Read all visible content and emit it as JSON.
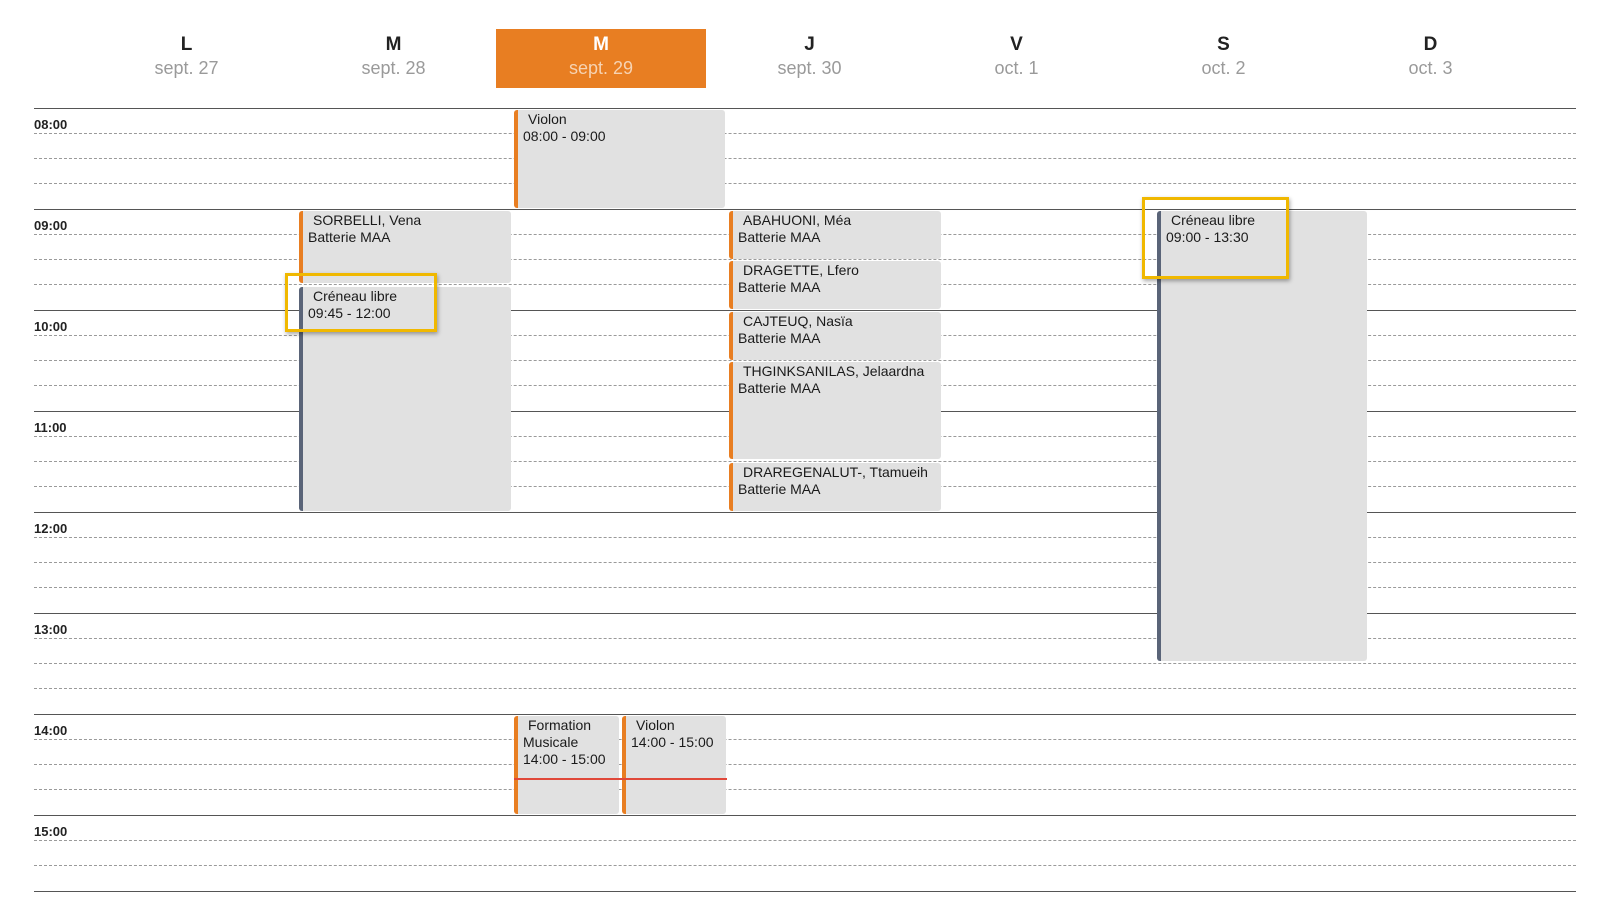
{
  "days": [
    {
      "letter": "L",
      "date": "sept. 27"
    },
    {
      "letter": "M",
      "date": "sept. 28"
    },
    {
      "letter": "M",
      "date": "sept. 29"
    },
    {
      "letter": "J",
      "date": "sept. 30"
    },
    {
      "letter": "V",
      "date": "oct. 1"
    },
    {
      "letter": "S",
      "date": "oct. 2"
    },
    {
      "letter": "D",
      "date": "oct. 3"
    }
  ],
  "active_day_index": 2,
  "hours": [
    "08:00",
    "09:00",
    "10:00",
    "11:00",
    "12:00",
    "13:00",
    "14:00",
    "15:00"
  ],
  "events": {
    "tue_sorbelli": {
      "line1": "SORBELLI, Vena",
      "line2": "Batterie MAA"
    },
    "tue_free": {
      "line1": "Créneau libre",
      "line2": "09:45 - 12:00"
    },
    "wed_violon_am": {
      "line1": "Violon",
      "line2": "08:00 - 09:00"
    },
    "wed_formation": {
      "line1": "Formation",
      "line2": "Musicale",
      "line3": "14:00 - 15:00"
    },
    "wed_violon_pm": {
      "line1": "Violon",
      "line2": "14:00 - 15:00"
    },
    "thu_abahuoni": {
      "line1": "ABAHUONI, Méa",
      "line2": "Batterie MAA"
    },
    "thu_dragette": {
      "line1": "DRAGETTE, Lfero",
      "line2": "Batterie MAA"
    },
    "thu_cajteuq": {
      "line1": "CAJTEUQ, Nasïa",
      "line2": "Batterie MAA"
    },
    "thu_thginksanilas": {
      "line1": "THGINKSANILAS, Jelaardna",
      "line2": "Batterie MAA"
    },
    "thu_draregenalut": {
      "line1": "DRAREGENALUT-, Ttamueih",
      "line2": "Batterie MAA"
    },
    "sat_free": {
      "line1": "Créneau libre",
      "line2": "09:00 - 13:30"
    }
  },
  "colors": {
    "accent": "#e87e22",
    "event_bg": "#e1e1e1",
    "free_slot_border": "#5a6478",
    "highlight": "#f0b800",
    "now_indicator": "#e0483a"
  }
}
